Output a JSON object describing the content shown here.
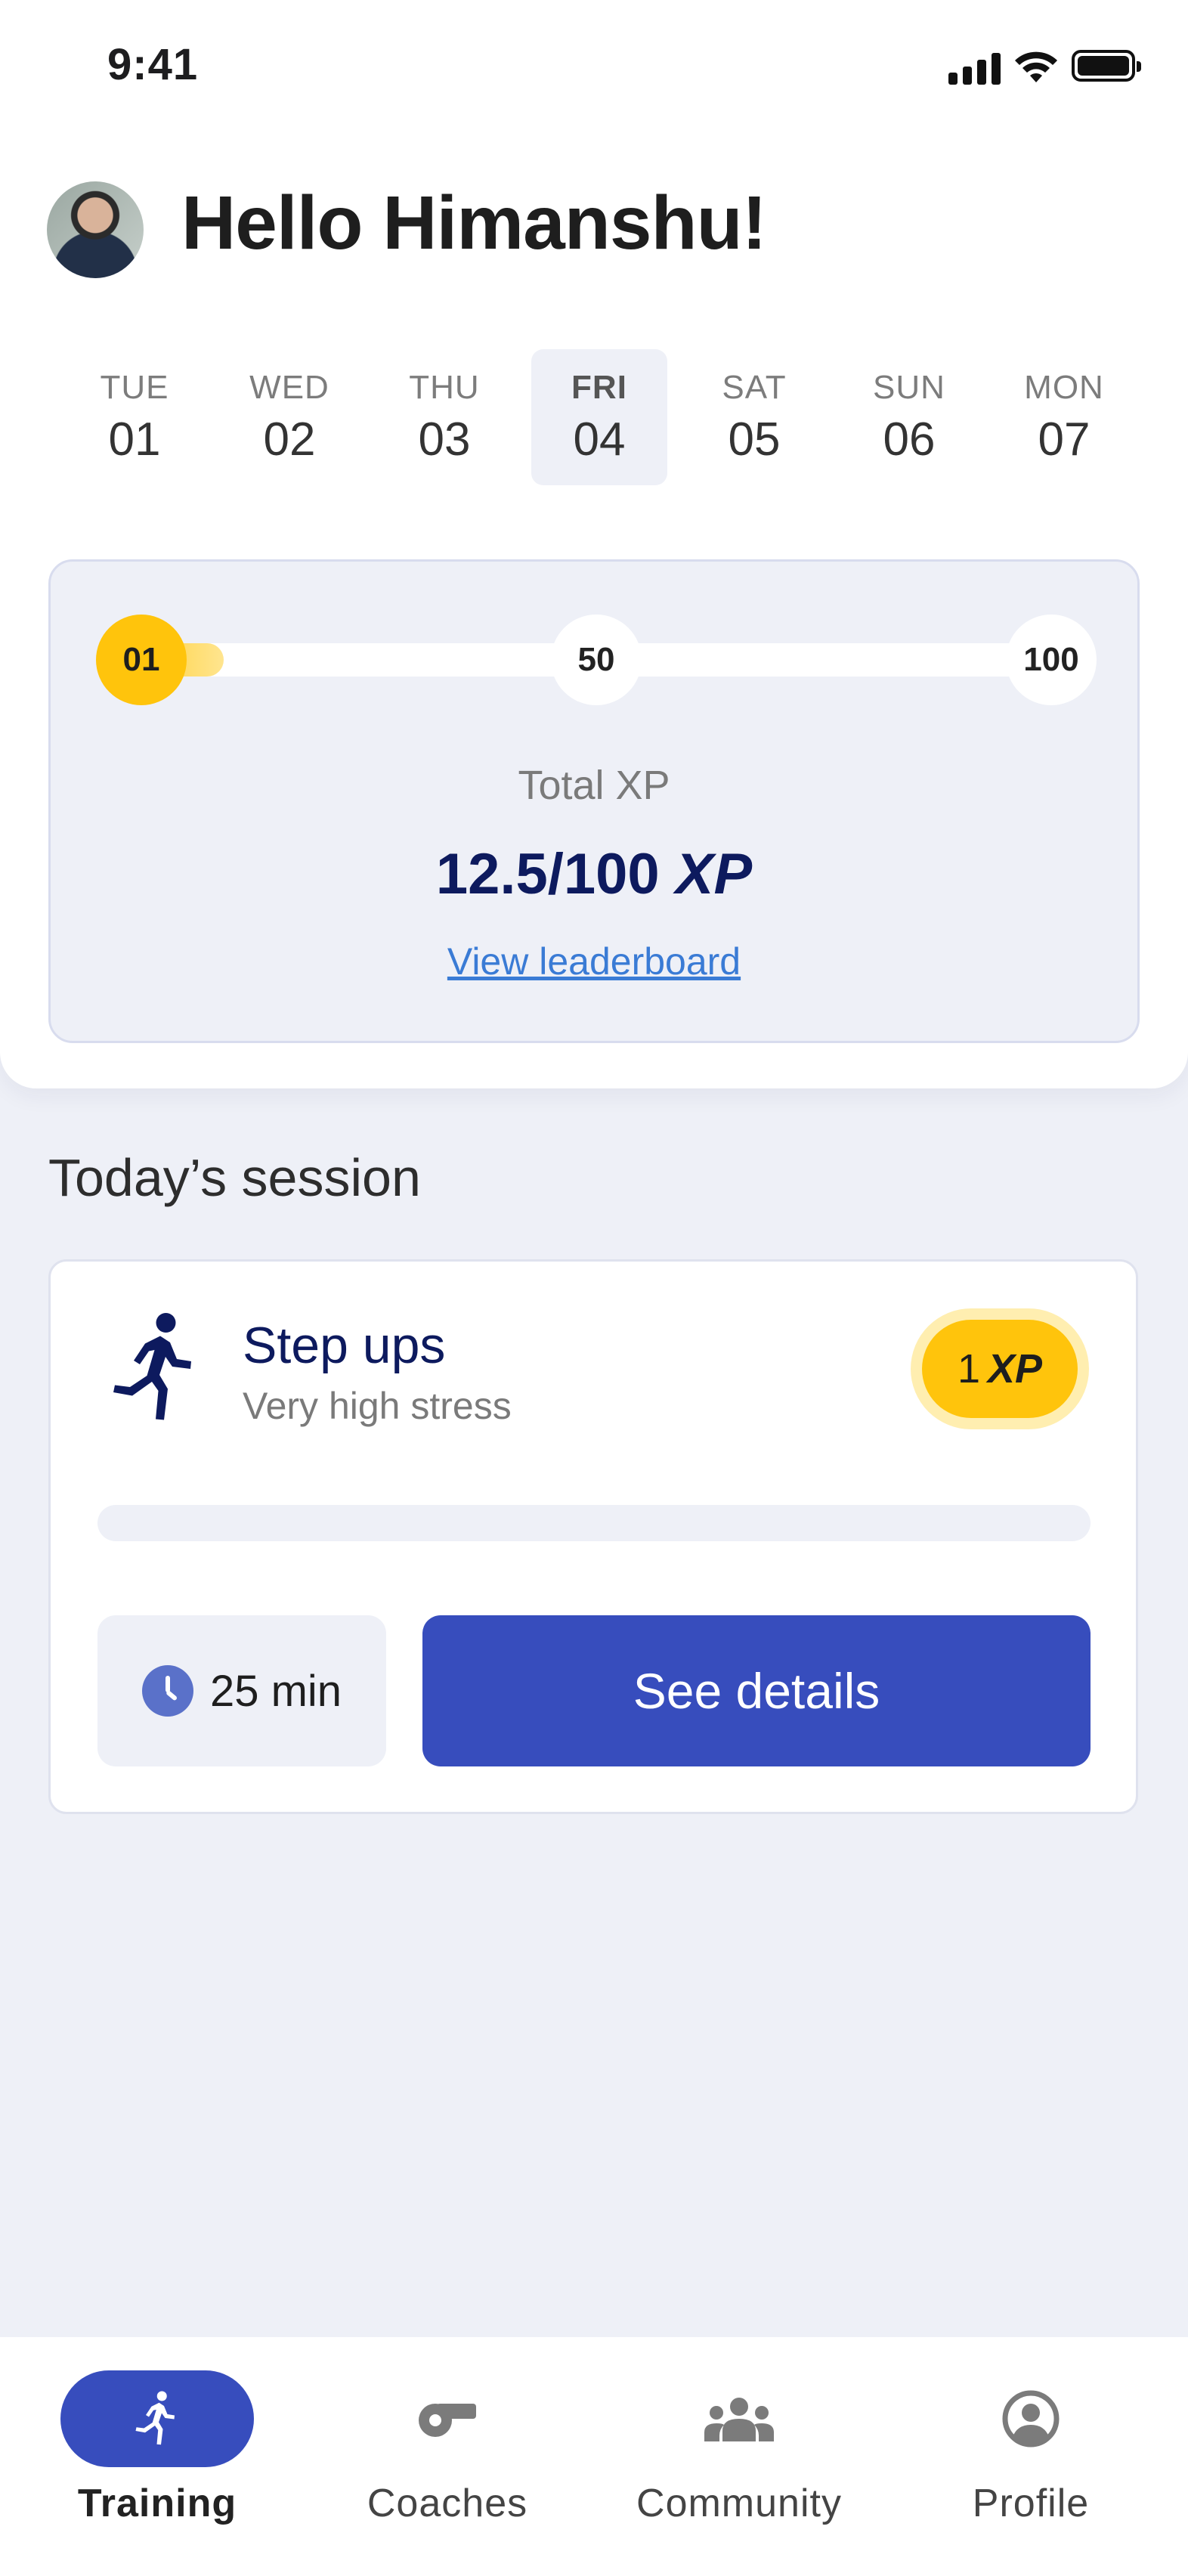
{
  "status_bar": {
    "time": "9:41"
  },
  "greeting": "Hello Himanshu!",
  "days": [
    {
      "name": "TUE",
      "num": "01"
    },
    {
      "name": "WED",
      "num": "02"
    },
    {
      "name": "THU",
      "num": "03"
    },
    {
      "name": "FRI",
      "num": "04"
    },
    {
      "name": "SAT",
      "num": "05"
    },
    {
      "name": "SUN",
      "num": "06"
    },
    {
      "name": "MON",
      "num": "07"
    }
  ],
  "selected_day_index": 3,
  "xp": {
    "milestones": [
      "01",
      "50",
      "100"
    ],
    "label": "Total XP",
    "value": "12.5/100",
    "unit": "XP",
    "progress_fraction": 0.125,
    "link": "View leaderboard"
  },
  "session": {
    "section_title": "Today’s session",
    "title": "Step ups",
    "subtitle": "Very high stress",
    "xp_amount": "1",
    "xp_unit": "XP",
    "duration": "25 min",
    "button": "See details"
  },
  "nav": {
    "items": [
      {
        "label": "Training",
        "icon": "runner-icon"
      },
      {
        "label": "Coaches",
        "icon": "whistle-icon"
      },
      {
        "label": "Community",
        "icon": "people-icon"
      },
      {
        "label": "Profile",
        "icon": "profile-icon"
      }
    ]
  },
  "colors": {
    "primary": "#374dbd",
    "accent_yellow": "#ffc40c",
    "navy_text": "#0d1a5e",
    "background": "#eef0f7"
  }
}
